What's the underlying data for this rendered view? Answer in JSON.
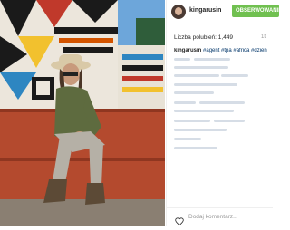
{
  "profile": {
    "username": "kingarusin",
    "follow_label": "OBSERWOWANIE"
  },
  "post": {
    "likes_label": "Liczba polubień: 1,449",
    "age": "1t",
    "caption_user": "kingarusin",
    "caption_tags": "#agent #tpa #africa #dzien"
  },
  "footer": {
    "comment_placeholder": "Dodaj komentarz..."
  },
  "icons": {
    "like": "heart-icon",
    "avatar": "profile-photo"
  },
  "colors": {
    "follow_button": "#70c050",
    "hashtag": "#003569",
    "muted_text": "#999999"
  }
}
